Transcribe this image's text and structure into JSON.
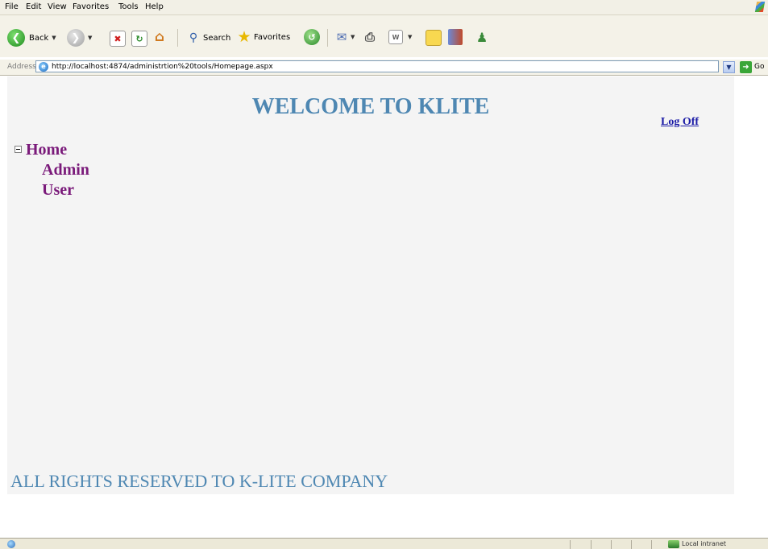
{
  "menu": {
    "items": [
      "File",
      "Edit",
      "View",
      "Favorites",
      "Tools",
      "Help"
    ]
  },
  "toolbar": {
    "back_label": "Back",
    "search_label": "Search",
    "favorites_label": "Favorites"
  },
  "addressbar": {
    "label": "Address",
    "url": "http://localhost:4874/administrtion%20tools/Homepage.aspx",
    "go_label": "Go"
  },
  "page": {
    "title": "WELCOME TO KLITE",
    "logoff_label": "Log Off",
    "tree": {
      "root": "Home",
      "children": [
        "Admin",
        "User"
      ]
    },
    "footer": "ALL RIGHTS RESERVED TO K-LITE COMPANY"
  },
  "statusbar": {
    "zone": "Local intranet"
  },
  "colors": {
    "title": "#4e87b2",
    "tree_link": "#7a1a7a",
    "logoff_link": "#1a1aa6",
    "page_background": "#f4f4f4"
  },
  "icons": [
    "back-icon",
    "forward-icon",
    "stop-icon",
    "refresh-icon",
    "home-icon",
    "search-icon",
    "favorites-star-icon",
    "history-icon",
    "mail-icon",
    "print-icon",
    "edit-icon",
    "folder-icon",
    "research-icon",
    "messenger-icon",
    "ie-page-icon",
    "go-arrow-icon",
    "collapse-icon",
    "zone-icon"
  ]
}
